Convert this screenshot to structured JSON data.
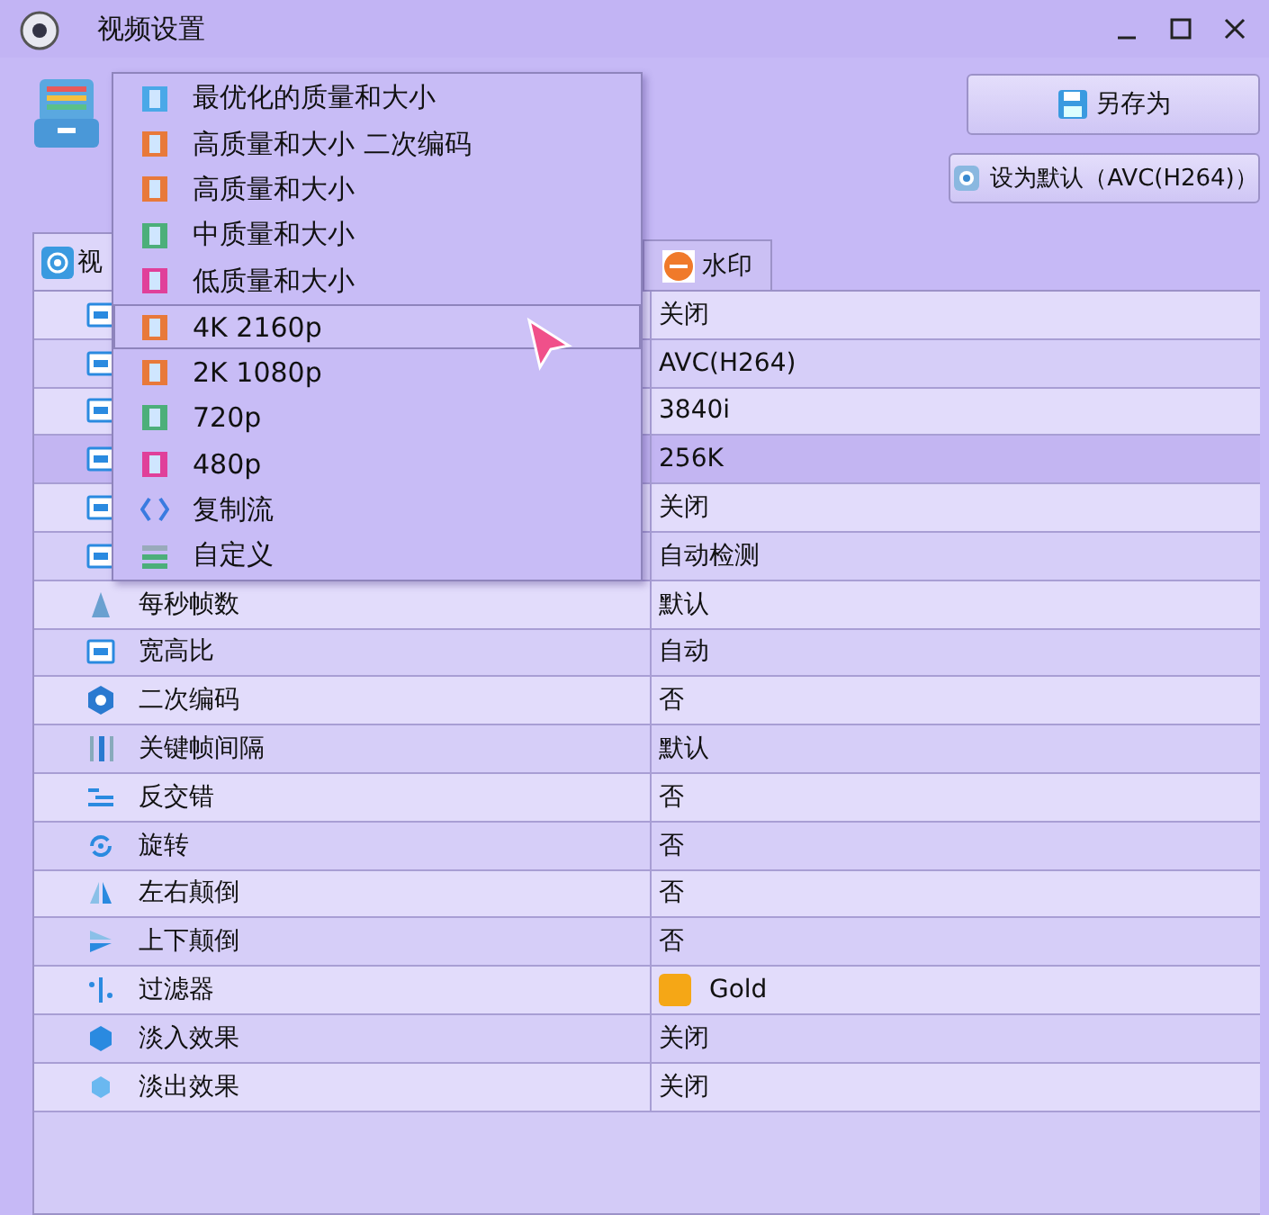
{
  "window": {
    "title": "视频设置"
  },
  "buttons": [
    {
      "label": "另存为",
      "kind": "save"
    },
    {
      "label": "设为默认（AVC(H264)）",
      "kind": "default"
    }
  ],
  "tabs": [
    {
      "label": "视",
      "selected": true,
      "kind": "video"
    },
    {
      "label": "水印",
      "selected": false,
      "kind": "watermark"
    }
  ],
  "rows": [
    {
      "value": "关闭",
      "selected": false
    },
    {
      "value": "AVC(H264)",
      "selected": false
    },
    {
      "value": "3840i",
      "selected": false
    },
    {
      "value": "256K",
      "selected": true
    },
    {
      "value": "关闭",
      "selected": false
    },
    {
      "value": "自动检测",
      "selected": false
    },
    {
      "label": "每秒帧数",
      "value": "默认",
      "selected": false
    },
    {
      "label": "宽高比",
      "value": "自动",
      "selected": false
    },
    {
      "label": "二次编码",
      "value": "否",
      "selected": false
    },
    {
      "label": "关键帧间隔",
      "value": "默认",
      "selected": false
    },
    {
      "label": "反交错",
      "value": "否",
      "selected": false
    },
    {
      "label": "旋转",
      "value": "否",
      "selected": false
    },
    {
      "label": "左右颠倒",
      "value": "否",
      "selected": false
    },
    {
      "label": "上下颠倒",
      "value": "否",
      "selected": false
    },
    {
      "label": "过滤器",
      "value": "Gold",
      "selected": false,
      "color": "#f5a716"
    },
    {
      "label": "淡入效果",
      "value": "关闭",
      "selected": false
    },
    {
      "label": "淡出效果",
      "value": "关闭",
      "selected": false
    }
  ],
  "menu": {
    "items": [
      {
        "label": "最优化的质量和大小",
        "kind": "film",
        "color": "#4aa8e8",
        "selected": false
      },
      {
        "label": "高质量和大小 二次编码",
        "kind": "film",
        "color": "#e8793a",
        "selected": false
      },
      {
        "label": "高质量和大小",
        "kind": "film",
        "color": "#e8793a",
        "selected": false
      },
      {
        "label": "中质量和大小",
        "kind": "film",
        "color": "#4caf7a",
        "selected": false
      },
      {
        "label": "低质量和大小",
        "kind": "film",
        "color": "#e0409a",
        "selected": false
      },
      {
        "label": "4K 2160p",
        "kind": "film",
        "color": "#e8793a",
        "selected": true
      },
      {
        "label": "2K 1080p",
        "kind": "film",
        "color": "#e8793a",
        "selected": false
      },
      {
        "label": "720p",
        "kind": "film",
        "color": "#4caf7a",
        "selected": false
      },
      {
        "label": "480p",
        "kind": "film",
        "color": "#e0409a",
        "selected": false
      },
      {
        "label": "复制流",
        "kind": "copy",
        "color": "#3a7be0",
        "selected": false
      },
      {
        "label": "自定义",
        "kind": "custom",
        "color": "#4caf7a",
        "selected": false
      }
    ]
  }
}
